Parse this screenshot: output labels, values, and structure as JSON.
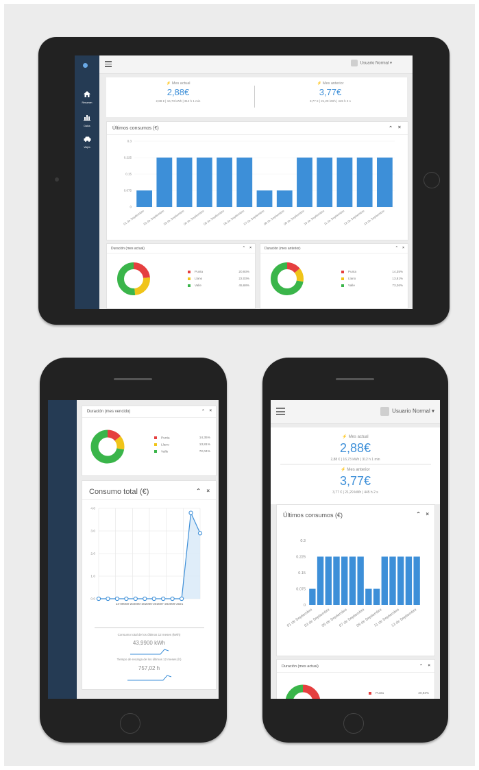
{
  "user": {
    "name": "Usuario Normal",
    "caret": "▾"
  },
  "nav": [
    {
      "label": "Resumen",
      "icon": "home-icon"
    },
    {
      "label": "Datos",
      "icon": "bar-chart-icon"
    },
    {
      "label": "Viajes",
      "icon": "car-icon"
    }
  ],
  "stats": {
    "current": {
      "label": "Mes actual",
      "value": "2,88€",
      "detail": "2,88 € | 16,73 kWh | 312 h 1 min"
    },
    "previous": {
      "label": "Mes anterior",
      "value": "3,77€",
      "detail": "3,77 € | 21,29 kWh | 445 h 2 s"
    }
  },
  "phone_stats_detail": {
    "current": "2,88 € | 16,73 kWh | 312 h 1 min",
    "previous": "3,77 € | 21,29 kWh | 445 h 2 s"
  },
  "panels": {
    "last_consumption": "Últimos consumos (€)",
    "duration_current": "Duración (mes actual)",
    "duration_previous": "Duración (mes anterior)",
    "duration_previous_phone": "Duración (mes vencido)",
    "total_consumption": "Consumo total (€)",
    "controls": {
      "collapse": "⌃",
      "close": "×"
    }
  },
  "legend": {
    "labels": [
      "Punta",
      "Llano",
      "Valle"
    ],
    "colors": [
      "#e53f3f",
      "#f0c419",
      "#3ab54a"
    ]
  },
  "tablet_legend_values": {
    "current": [
      "20,93%",
      "22,03%",
      "45,68%"
    ],
    "previous": [
      "14,35%",
      "13,81%",
      "73,26%"
    ]
  },
  "phone_legend_values": {
    "previous": [
      "14,35%",
      "13,81%",
      "72,04%"
    ],
    "current_punta": "20,93%"
  },
  "chart_data": [
    {
      "type": "bar",
      "title": "Últimos consumos (€)",
      "categories": [
        "01 de Septiembre",
        "02 de Septiembre",
        "03 de Septiembre",
        "04 de Septiembre",
        "05 de Septiembre",
        "06 de Septiembre",
        "07 de Septiembre",
        "08 de Septiembre",
        "09 de Septiembre",
        "10 de Septiembre",
        "11 de Septiembre",
        "12 de Septiembre",
        "13 de Septiembre"
      ],
      "values": [
        0.075,
        0.225,
        0.225,
        0.225,
        0.225,
        0.225,
        0.075,
        0.075,
        0.225,
        0.225,
        0.225,
        0.225,
        0.225
      ],
      "yticks": [
        "0",
        "0.075",
        "0.15",
        "0.225",
        "0.3"
      ],
      "ylim": [
        0,
        0.3
      ],
      "color": "#3d8fd8"
    },
    {
      "type": "bar",
      "title": "Últimos consumos (€)",
      "categories": [
        "01 de Septiembre",
        "02 de Septiembre",
        "03 de Septiembre",
        "04 de Septiembre",
        "05 de Septiembre",
        "06 de Septiembre",
        "07 de Septiembre",
        "08 de Septiembre",
        "09 de Septiembre",
        "10 de Septiembre",
        "11 de Septiembre",
        "12 de Septiembre",
        "13 de Septiembre"
      ],
      "values": [
        0.075,
        0.225,
        0.225,
        0.225,
        0.225,
        0.225,
        0.225,
        0.075,
        0.075,
        0.225,
        0.225,
        0.225,
        0.225,
        0.225
      ],
      "xticks": [
        "01 de Septiembre",
        "03 de Septiembre",
        "05 de Septiembre",
        "07 de Septiembre",
        "09 de Septiembre",
        "11 de Septiembre",
        "13 de Septiembre"
      ],
      "yticks": [
        "0",
        "0.075",
        "0.15",
        "0.225",
        "0.3"
      ],
      "ylim": [
        0,
        0.3
      ],
      "color": "#3d8fd8"
    },
    {
      "type": "pie",
      "title": "Duración (mes actual)",
      "labels": [
        "Punta",
        "Llano",
        "Valle"
      ],
      "values": [
        20.93,
        22.03,
        45.68
      ]
    },
    {
      "type": "pie",
      "title": "Duración (mes anterior)",
      "labels": [
        "Punta",
        "Llano",
        "Valle"
      ],
      "values": [
        14.35,
        13.81,
        73.26
      ]
    },
    {
      "type": "line",
      "title": "Consumo total (€)",
      "x": [
        "1",
        "2",
        "3",
        "4",
        "5",
        "6",
        "7",
        "8",
        "9",
        "10",
        "11",
        "12"
      ],
      "values": [
        0,
        0,
        0,
        0,
        0,
        0,
        0,
        0,
        0,
        0,
        3.8,
        2.9
      ],
      "yticks": [
        "0.0",
        "1.0",
        "2.0",
        "3.0",
        "4.0"
      ],
      "ylim": [
        0,
        4
      ],
      "xticks_text": "14-09000-202000-202000-202007-202009-2021",
      "color": "#3d8fd8"
    }
  ],
  "phone_summary": {
    "total_label": "Consumo total de los últimos 12 meses (kWh)",
    "total_value": "43,9900 kWh",
    "time_label": "Tiempo de recarga de los últimos 12 meses (h)",
    "time_value": "757,02 h"
  }
}
